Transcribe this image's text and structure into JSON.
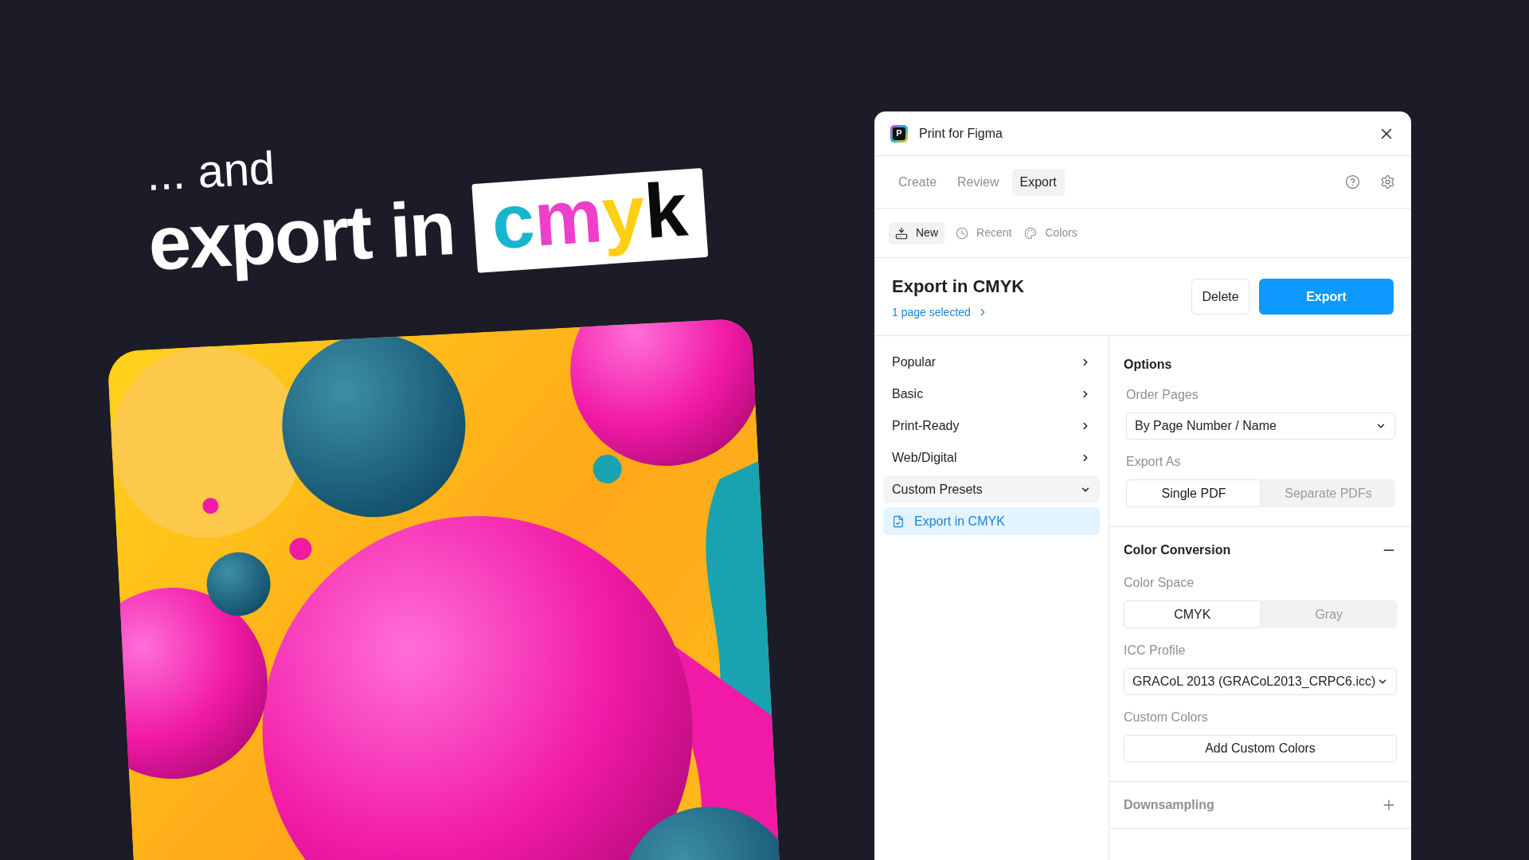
{
  "headline": {
    "intro": "... and",
    "main": "export in",
    "highlight": [
      {
        "text": "c",
        "color": "#19b5cf"
      },
      {
        "text": "m",
        "color": "#ee3fcb"
      },
      {
        "text": "y",
        "color": "#fccf12"
      },
      {
        "text": "k",
        "color": "#0a0a0a"
      }
    ]
  },
  "window": {
    "logo_letter": "P",
    "title": "Print for Figma"
  },
  "tabs": [
    {
      "label": "Create",
      "selected": false
    },
    {
      "label": "Review",
      "selected": false
    },
    {
      "label": "Export",
      "selected": true
    }
  ],
  "subtabs": [
    {
      "label": "New",
      "selected": true
    },
    {
      "label": "Recent",
      "selected": false
    },
    {
      "label": "Colors",
      "selected": false
    }
  ],
  "preset": {
    "title": "Export in CMYK",
    "selection": "1 page selected",
    "buttons": [
      {
        "label": "Delete",
        "kind": "secondary"
      },
      {
        "label": "Export",
        "kind": "primary"
      }
    ]
  },
  "presets": [
    {
      "label": "Popular",
      "expanded": false
    },
    {
      "label": "Basic",
      "expanded": false
    },
    {
      "label": "Print-Ready",
      "expanded": false
    },
    {
      "label": "Web/Digital",
      "expanded": false
    },
    {
      "label": "Custom Presets",
      "expanded": true,
      "children": [
        {
          "label": "Export in CMYK",
          "selected": true
        }
      ]
    }
  ],
  "options": {
    "title": "Options",
    "fields": [
      {
        "kind": "select",
        "label": "Order Pages",
        "value": "By Page Number / Name"
      },
      {
        "kind": "segmented",
        "label": "Export As",
        "options": [
          {
            "label": "Single PDF",
            "selected": true
          },
          {
            "label": "Separate PDFs",
            "selected": false
          }
        ]
      }
    ]
  },
  "sections": [
    {
      "title": "Color Conversion",
      "expanded": true,
      "fields": [
        {
          "kind": "segmented",
          "label": "Color Space",
          "options": [
            {
              "label": "CMYK",
              "selected": true
            },
            {
              "label": "Gray",
              "selected": false
            }
          ]
        },
        {
          "kind": "select",
          "label": "ICC Profile",
          "value": "GRACoL 2013 (GRACoL2013_CRPC6.icc)"
        },
        {
          "kind": "button",
          "label": "Custom Colors",
          "value": "Add Custom Colors"
        }
      ]
    },
    {
      "title": "Downsampling",
      "expanded": false
    }
  ]
}
